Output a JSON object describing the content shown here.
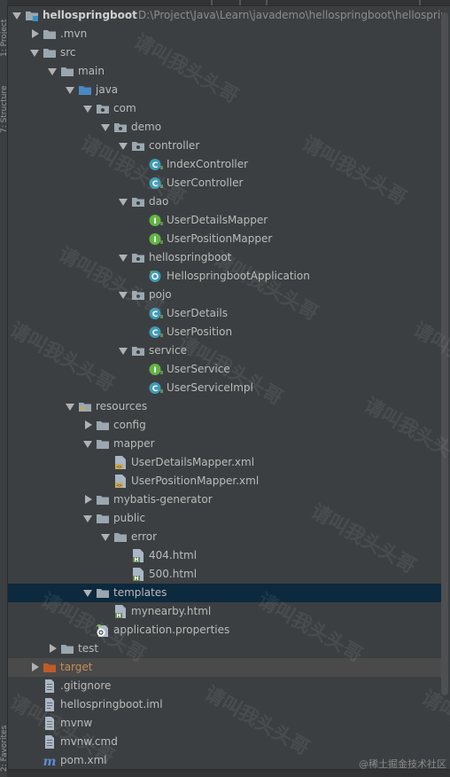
{
  "sidebar": {
    "project_label": "1: Project",
    "structure_label": "7: Structure",
    "favorites_label": "2: Favorites"
  },
  "tree": [
    {
      "label": "hellospringboot",
      "path": "D:\\Project\\Java\\Learn\\javademo\\hellospringboot\\hellosprin",
      "depth": 0,
      "expanded": true,
      "icon": "module-folder-icon"
    },
    {
      "label": ".mvn",
      "depth": 1,
      "expanded": false,
      "icon": "folder-icon"
    },
    {
      "label": "src",
      "depth": 1,
      "expanded": true,
      "icon": "folder-icon"
    },
    {
      "label": "main",
      "depth": 2,
      "expanded": true,
      "icon": "folder-icon"
    },
    {
      "label": "java",
      "depth": 3,
      "expanded": true,
      "icon": "source-folder-icon"
    },
    {
      "label": "com",
      "depth": 4,
      "expanded": true,
      "icon": "package-icon"
    },
    {
      "label": "demo",
      "depth": 5,
      "expanded": true,
      "icon": "package-icon"
    },
    {
      "label": "controller",
      "depth": 6,
      "expanded": true,
      "icon": "package-icon"
    },
    {
      "label": "IndexController",
      "depth": 7,
      "icon": "class-icon"
    },
    {
      "label": "UserController",
      "depth": 7,
      "icon": "class-icon"
    },
    {
      "label": "dao",
      "depth": 6,
      "expanded": true,
      "icon": "package-icon"
    },
    {
      "label": "UserDetailsMapper",
      "depth": 7,
      "icon": "interface-icon"
    },
    {
      "label": "UserPositionMapper",
      "depth": 7,
      "icon": "interface-icon"
    },
    {
      "label": "hellospringboot",
      "depth": 6,
      "expanded": true,
      "icon": "package-icon"
    },
    {
      "label": "HellospringbootApplication",
      "depth": 7,
      "icon": "spring-boot-class-icon"
    },
    {
      "label": "pojo",
      "depth": 6,
      "expanded": true,
      "icon": "package-icon"
    },
    {
      "label": "UserDetails",
      "depth": 7,
      "icon": "class-icon"
    },
    {
      "label": "UserPosition",
      "depth": 7,
      "icon": "class-icon"
    },
    {
      "label": "service",
      "depth": 6,
      "expanded": true,
      "icon": "package-icon"
    },
    {
      "label": "UserService",
      "depth": 7,
      "icon": "interface-icon"
    },
    {
      "label": "UserServiceImpl",
      "depth": 7,
      "icon": "class-icon"
    },
    {
      "label": "resources",
      "depth": 3,
      "expanded": true,
      "icon": "resources-folder-icon"
    },
    {
      "label": "config",
      "depth": 4,
      "expanded": false,
      "icon": "folder-icon"
    },
    {
      "label": "mapper",
      "depth": 4,
      "expanded": true,
      "icon": "folder-icon"
    },
    {
      "label": "UserDetailsMapper.xml",
      "depth": 5,
      "icon": "xml-file-icon"
    },
    {
      "label": "UserPositionMapper.xml",
      "depth": 5,
      "icon": "xml-file-icon"
    },
    {
      "label": "mybatis-generator",
      "depth": 4,
      "expanded": false,
      "icon": "folder-icon"
    },
    {
      "label": "public",
      "depth": 4,
      "expanded": true,
      "icon": "folder-icon"
    },
    {
      "label": "error",
      "depth": 5,
      "expanded": true,
      "icon": "folder-icon"
    },
    {
      "label": "404.html",
      "depth": 6,
      "icon": "html-file-icon"
    },
    {
      "label": "500.html",
      "depth": 6,
      "icon": "html-file-icon"
    },
    {
      "label": "templates",
      "depth": 4,
      "expanded": true,
      "icon": "folder-icon",
      "selected": true
    },
    {
      "label": "mynearby.html",
      "depth": 5,
      "icon": "html-file-icon"
    },
    {
      "label": "application.properties",
      "depth": 4,
      "icon": "properties-file-icon"
    },
    {
      "label": "test",
      "depth": 2,
      "expanded": false,
      "icon": "folder-icon"
    },
    {
      "label": "target",
      "depth": 1,
      "expanded": false,
      "icon": "excluded-folder-icon",
      "orange": true,
      "sel2": true
    },
    {
      "label": ".gitignore",
      "depth": 1,
      "icon": "text-file-icon"
    },
    {
      "label": "hellospringboot.iml",
      "depth": 1,
      "icon": "iml-file-icon"
    },
    {
      "label": "mvnw",
      "depth": 1,
      "icon": "text-file-icon"
    },
    {
      "label": "mvnw.cmd",
      "depth": 1,
      "icon": "text-file-icon"
    },
    {
      "label": "pom.xml",
      "depth": 1,
      "icon": "maven-file-icon"
    }
  ],
  "watermark": "请叫我头头哥",
  "brand": "@稀土掘金技术社区",
  "colors": {
    "background": "#3c3f41",
    "selection": "#0d293e",
    "folder": "#9aa7b0",
    "class": "#3d9bb7",
    "interface": "#62b543",
    "excluded": "#c05a28"
  }
}
